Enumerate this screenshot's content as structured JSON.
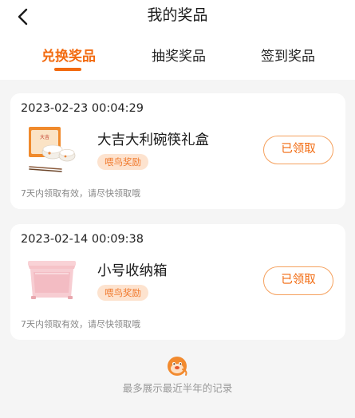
{
  "header": {
    "title": "我的奖品",
    "back_icon": "chevron-left-icon"
  },
  "tabs": [
    {
      "label": "兑换奖品",
      "active": true
    },
    {
      "label": "抽奖奖品",
      "active": false
    },
    {
      "label": "签到奖品",
      "active": false
    }
  ],
  "colors": {
    "accent": "#f26a0f",
    "tag_bg": "#fde3cf",
    "page_bg": "#f5f5f5"
  },
  "prizes": [
    {
      "time": "2023-02-23 00:04:29",
      "name": "大吉大利碗筷礼盒",
      "tag": "喂鸟奖励",
      "status": "已领取",
      "note": "7天内领取有效，请尽快领取哦",
      "image_icon": "bowl-chopsticks-giftbox-image"
    },
    {
      "time": "2023-02-14 00:09:38",
      "name": "小号收纳箱",
      "tag": "喂鸟奖励",
      "status": "已领取",
      "note": "7天内领取有效，请尽快领取哦",
      "image_icon": "storage-box-image"
    }
  ],
  "footer": {
    "text": "最多展示最近半年的记录",
    "icon": "bird-mascot-icon"
  }
}
